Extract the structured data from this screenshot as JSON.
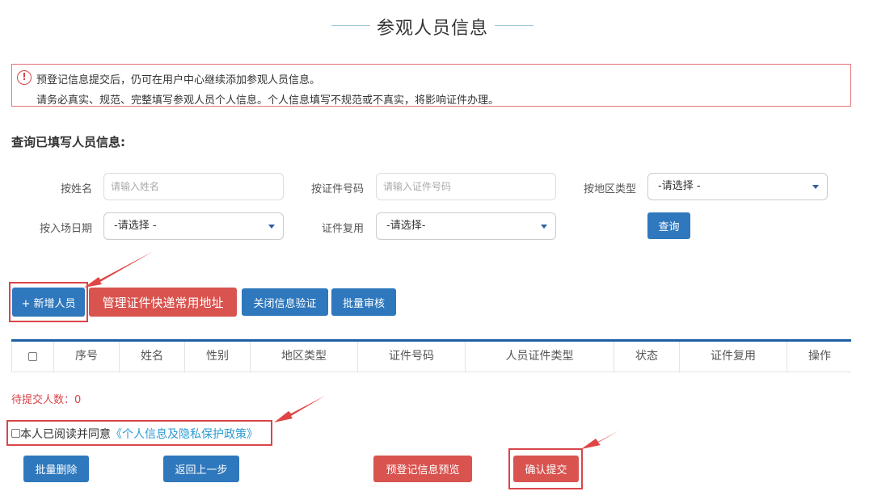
{
  "page": {
    "title": "参观人员信息"
  },
  "notice": {
    "icon": "alert-circle-icon",
    "line1": "预登记信息提交后，仍可在用户中心继续添加参观人员信息。",
    "line2": "请务必真实、规范、完整填写参观人员个人信息。个人信息填写不规范或不真实，将影响证件办理。"
  },
  "query": {
    "section_title": "查询已填写人员信息:",
    "name_label": "按姓名",
    "name_placeholder": "请输入姓名",
    "id_label": "按证件号码",
    "id_placeholder": "请输入证件号码",
    "region_label": "按地区类型",
    "region_value": "-请选择 -",
    "date_label": "按入场日期",
    "date_value": "-请选择 -",
    "reuse_label": "证件复用",
    "reuse_value": "-请选择-",
    "search_button": "查询"
  },
  "toolbar": {
    "add_button": "+ 新增人员",
    "manage_address_button": "管理证件快递常用地址",
    "close_verify_button": "关闭信息验证",
    "batch_review_button": "批量审核"
  },
  "table": {
    "columns": [
      "序号",
      "姓名",
      "性别",
      "地区类型",
      "证件号码",
      "人员证件类型",
      "状态",
      "证件复用",
      "操作"
    ]
  },
  "footer": {
    "pending_text": "待提交人数：0",
    "agree_text": "本人已阅读并同意",
    "agree_link": "《个人信息及隐私保护政策》",
    "batch_delete_button": "批量删除",
    "back_button": "返回上一步",
    "preview_button": "预登记信息预览",
    "confirm_button": "确认提交"
  },
  "colors": {
    "primary_blue": "#2f78bd",
    "danger_red": "#d9534f",
    "highlight_red": "#d9454a",
    "link_blue": "#2d9bd3"
  }
}
